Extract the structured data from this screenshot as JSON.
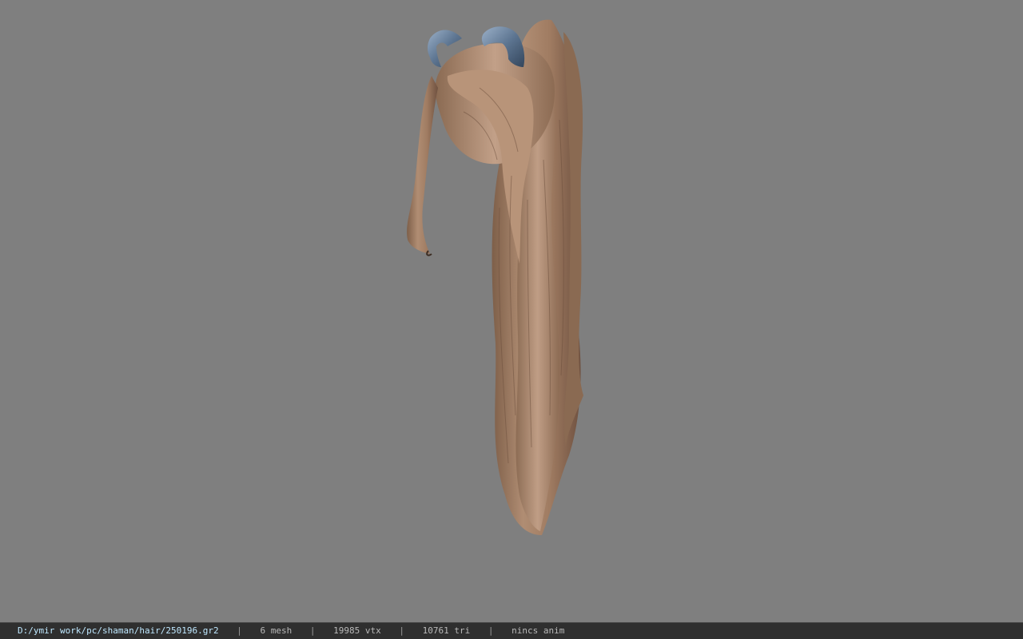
{
  "viewer": {
    "background_color": "#7f7f7f",
    "model": {
      "subject": "long ponytail hair mesh with hair ornaments",
      "hair_color": "#a98367",
      "ornament_color": "#6f86a3"
    }
  },
  "statusbar": {
    "file_path": "D:/ymir work/pc/shaman/hair/250196.gr2",
    "separator": "|",
    "mesh_count": "6 mesh",
    "vertex_count": "19985 vtx",
    "triangle_count": "10761 tri",
    "anim_status": "nincs anim"
  }
}
